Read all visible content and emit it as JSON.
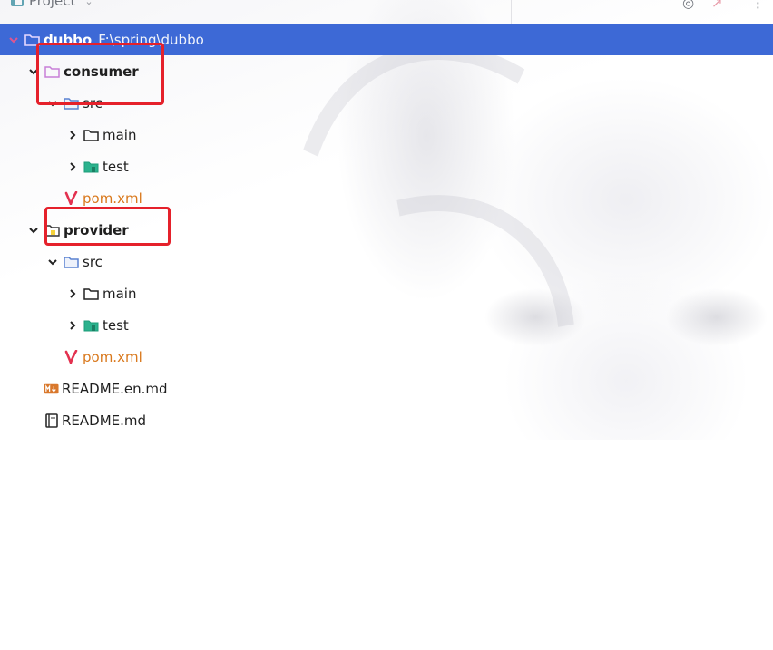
{
  "header": {
    "panel_title": "Project"
  },
  "tree": {
    "root": {
      "name": "dubbo",
      "path": "F:\\spring\\dubbo"
    },
    "consumer": {
      "name": "consumer",
      "src": "src",
      "main": "main",
      "test": "test",
      "pom": "pom.xml"
    },
    "provider": {
      "name": "provider",
      "src": "src",
      "main": "main",
      "test": "test",
      "pom": "pom.xml"
    },
    "readme_en": "README.en.md",
    "readme": "README.md"
  },
  "colors": {
    "selection": "#3d69d6",
    "highlight_box": "#e5212b",
    "pom_text": "#d9781c",
    "module_folder": "#c77fd8",
    "src_folder": "#5a82d1",
    "test_folder": "#2bb28d"
  },
  "icons": {
    "module_folder": "folder-module-icon",
    "source_folder": "folder-source-icon",
    "plain_folder": "folder-icon",
    "test_folder": "folder-test-icon",
    "maven_file": "maven-icon",
    "markdown_file": "markdown-icon",
    "book_file": "readme-book-icon"
  }
}
